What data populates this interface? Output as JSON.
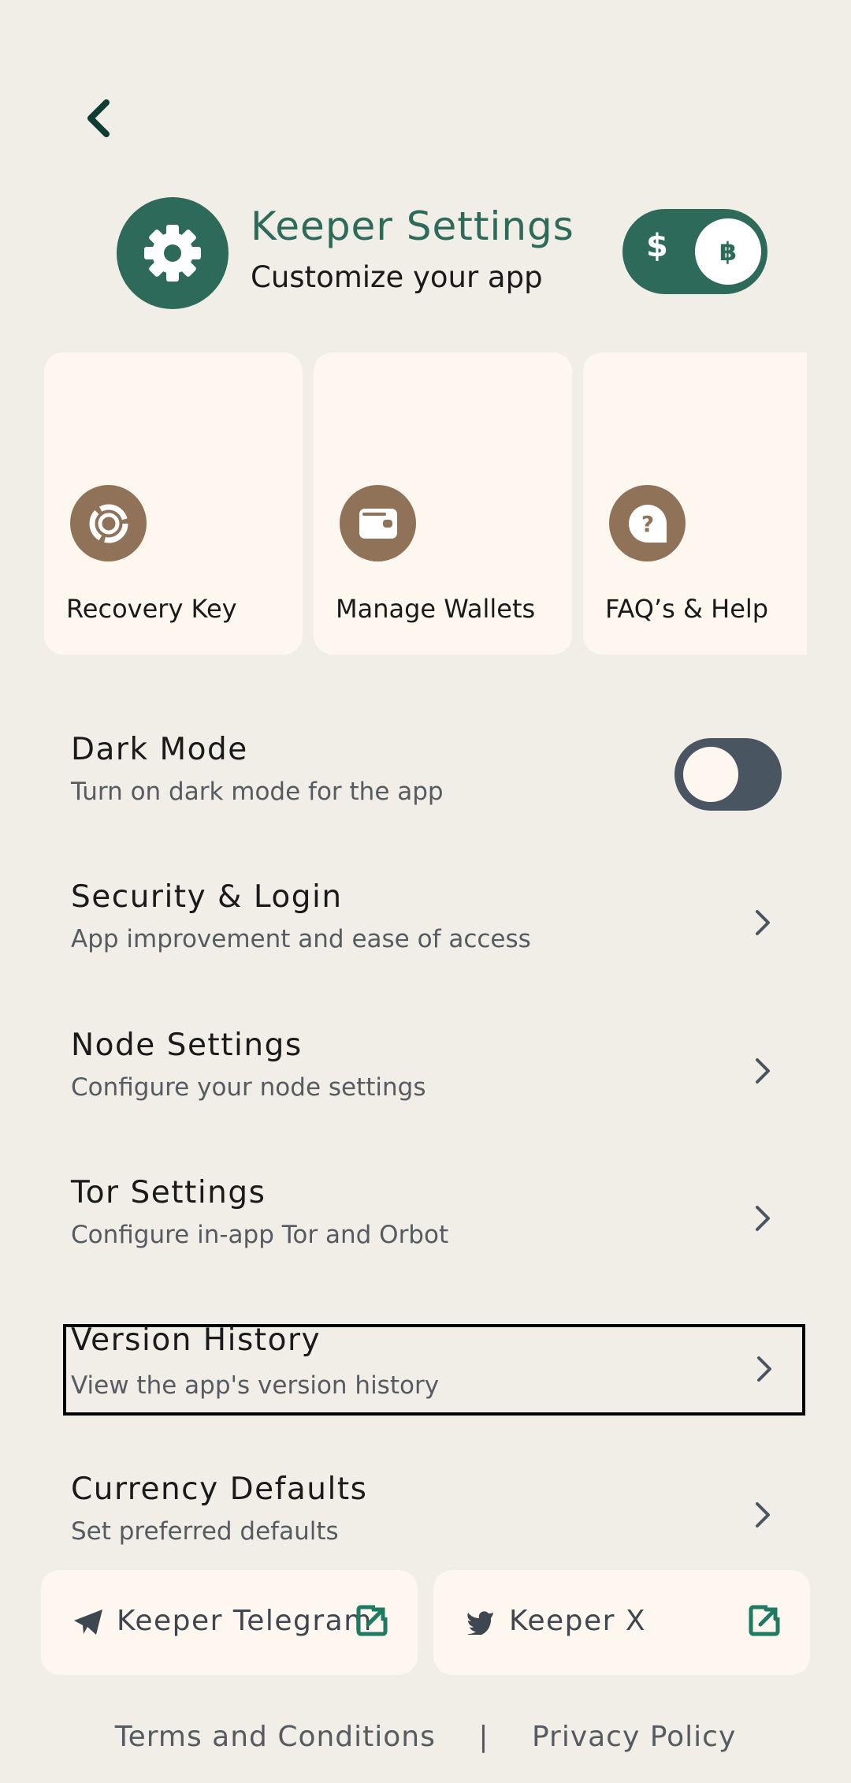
{
  "colors": {
    "background": "#F0EEE7",
    "card": "#FDF7F0",
    "accent_green": "#2D6A5A",
    "card_icon_brown": "#8F7258",
    "toggle_off": "#4A5562"
  },
  "back": {
    "icon": "chevron-left-icon"
  },
  "header": {
    "icon": "gear-icon",
    "title": "Keeper Settings",
    "subtitle": "Customize your app",
    "currency_toggle": {
      "left_symbol": "$",
      "right_symbol": "฿",
      "selected": "฿"
    }
  },
  "cards": [
    {
      "label": "Recovery Key",
      "icon": "recovery-key-icon"
    },
    {
      "label": "Manage Wallets",
      "icon": "wallet-icon"
    },
    {
      "label": "FAQ’s & Help",
      "icon": "help-icon"
    }
  ],
  "settings": [
    {
      "title": "Dark Mode",
      "subtitle": "Turn on dark mode for the app",
      "toggle": false
    },
    {
      "title": "Security & Login",
      "subtitle": "App improvement and ease of access"
    },
    {
      "title": "Node Settings",
      "subtitle": "Configure your node settings"
    },
    {
      "title": "Tor Settings",
      "subtitle": "Configure in-app Tor and Orbot"
    },
    {
      "title": "Version History",
      "subtitle": "View the app's version history",
      "focused": true
    },
    {
      "title": "Currency Defaults",
      "subtitle": "Set preferred defaults"
    }
  ],
  "social": [
    {
      "label": "Keeper Telegram",
      "icon": "telegram-icon"
    },
    {
      "label": "Keeper X",
      "icon": "twitter-icon"
    }
  ],
  "footer": {
    "terms": "Terms and Conditions",
    "separator": "|",
    "privacy": "Privacy Policy"
  }
}
